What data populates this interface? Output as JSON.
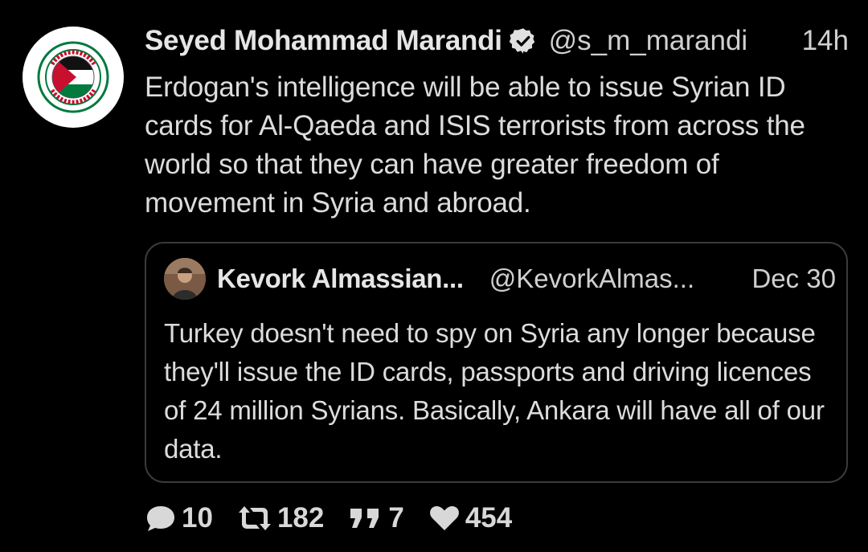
{
  "tweet": {
    "author": {
      "display_name": "Seyed Mohammad Marandi",
      "handle": "@s_m_marandi",
      "avatar_icon": "save-gaza-palestine-badge",
      "avatar_text_top": "SAVE GAZA",
      "avatar_text_bottom": "SAVE PALESTINE",
      "verified": true
    },
    "time": "14h",
    "text": "Erdogan's intelligence will be able to issue Syrian ID cards for Al-Qaeda and ISIS terrorists from across the world so that they can have greater freedom of movement in Syria and abroad.",
    "quoted": {
      "display_name": "Kevork Almassian...",
      "handle": "@KevorkAlmas...",
      "time": "Dec 30",
      "text": "Turkey doesn't need to spy on Syria any longer because they'll issue the ID cards, passports and driving licences of 24 million Syrians. Basically, Ankara will have all of our data."
    },
    "actions": {
      "replies": "10",
      "retweets": "182",
      "quotes": "7",
      "likes": "454"
    }
  },
  "colors": {
    "background": "#000000",
    "text": "#dcdcdc",
    "verified_badge": "#e0e0e0",
    "border": "#3a3a3a",
    "flag_red": "#c8102e",
    "flag_green": "#007a3d"
  }
}
